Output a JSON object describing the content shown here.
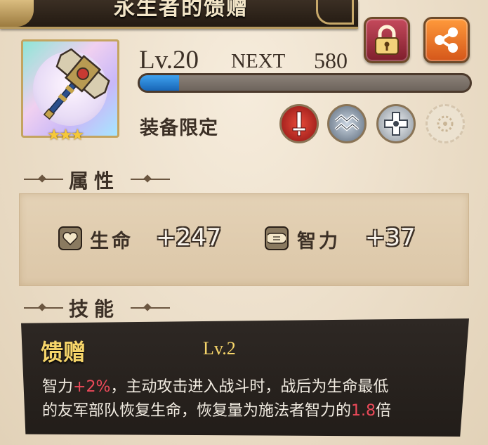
{
  "title": "永生者的馈赠",
  "level": {
    "label": "Lv.20",
    "next_label": "NEXT",
    "next_value": "580",
    "progress_percent": 12
  },
  "equip_limit": "装备限定",
  "rarity_stars": "★★★",
  "class_icons": [
    "sword-icon",
    "wave-icon",
    "cross-icon",
    "dim-class-icon"
  ],
  "sections": {
    "attributes": "属性",
    "skills": "技能"
  },
  "attributes": [
    {
      "icon": "heart-icon",
      "label": "生命",
      "value": "+247"
    },
    {
      "icon": "scroll-icon",
      "label": "智力",
      "value": "+37"
    }
  ],
  "skill": {
    "name": "馈赠",
    "level": "Lv.2",
    "line1": {
      "a": "智力",
      "hl1": "+2%",
      "b": "，主动攻击进入战斗时，战后为生命最低"
    },
    "line2": {
      "a": "的友军部队恢复生命，恢复量为施法者智力的",
      "hl1": "1.8",
      "b": "倍"
    }
  },
  "colors": {
    "highlight": "#ee4a5a",
    "skill_title": "#f6d56a",
    "xp_fill": "#2a82d4"
  }
}
